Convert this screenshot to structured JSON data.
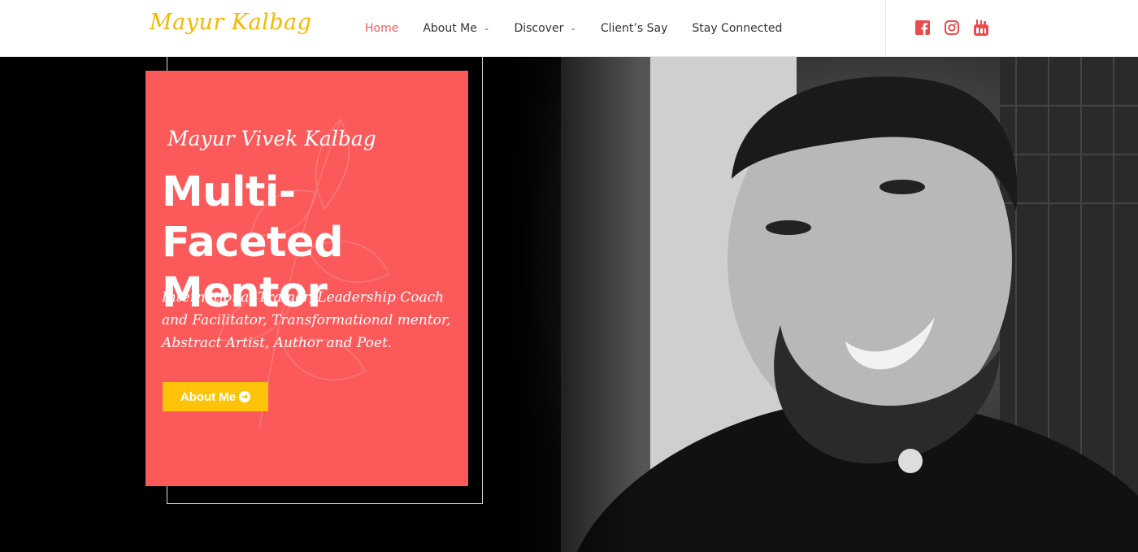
{
  "header": {
    "logo_text": "Mayur Kalbag",
    "nav": [
      {
        "label": "Home",
        "active": true,
        "dropdown": false
      },
      {
        "label": "About Me",
        "active": false,
        "dropdown": true
      },
      {
        "label": "Discover",
        "active": false,
        "dropdown": true
      },
      {
        "label": "Client’s Say",
        "active": false,
        "dropdown": false
      },
      {
        "label": "Stay Connected",
        "active": false,
        "dropdown": false
      }
    ],
    "social": [
      "facebook-icon",
      "instagram-icon",
      "youtube-icon"
    ]
  },
  "hero": {
    "name": "Mayur Vivek Kalbag",
    "title": "Multi-Faceted Mentor",
    "description": "International Trainer, Leadership Coach and Facilitator, Transformational mentor, Abstract Artist, Author and Poet.",
    "button_label": "About Me"
  },
  "colors": {
    "accent_red": "#fc5a5a",
    "logo_yellow": "#f5b700",
    "button_yellow": "#ffc40a",
    "nav_active": "#f25a5a"
  }
}
